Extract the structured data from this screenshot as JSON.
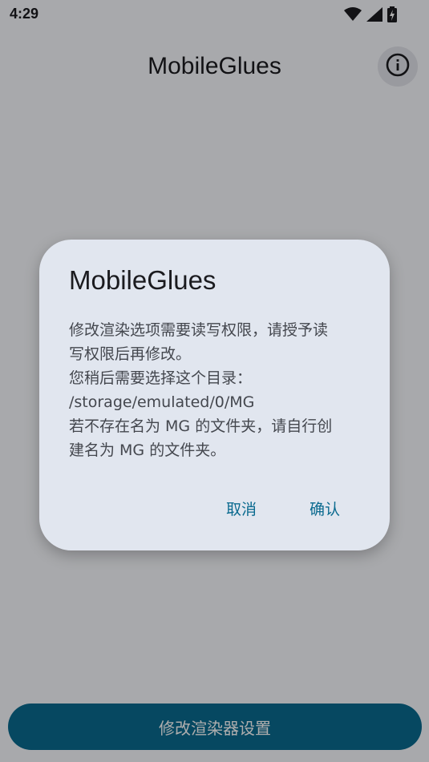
{
  "status_bar": {
    "time": "4:29"
  },
  "app_bar": {
    "title": "MobileGlues",
    "info_icon": "info-circle-icon"
  },
  "main": {
    "primary_button_label": "修改渲染器设置"
  },
  "dialog": {
    "title": "MobileGlues",
    "message_lines": [
      "修改渲染选项需要读写权限，请授予读",
      "写权限后再修改。",
      "您稍后需要选择这个目录：",
      "/storage/emulated/0/MG",
      "若不存在名为 MG 的文件夹，请自行创",
      "建名为 MG 的文件夹。"
    ],
    "cancel_label": "取消",
    "confirm_label": "确认"
  },
  "colors": {
    "accent": "#0a6a8f",
    "dialog_surface": "#e1e6ef",
    "background": "#f8f9fe"
  }
}
